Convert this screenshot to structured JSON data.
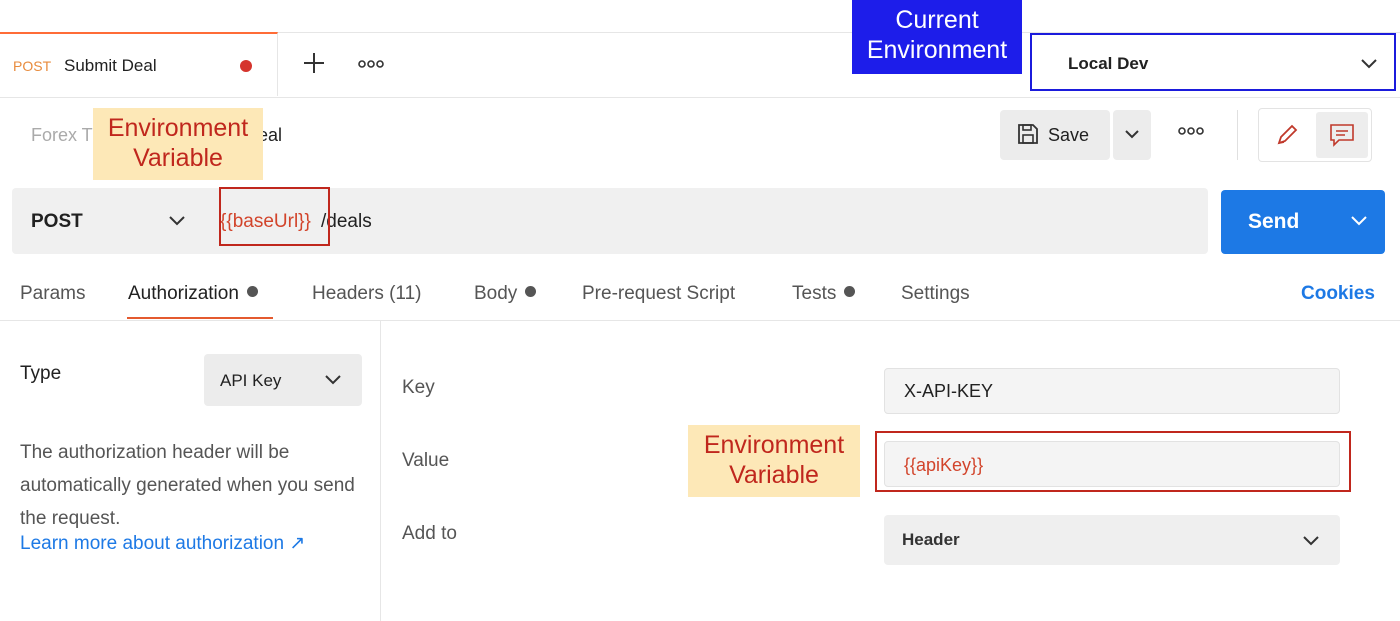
{
  "request_tab": {
    "method": "POST",
    "title": "Submit Deal"
  },
  "environment": {
    "selected": "Local Dev"
  },
  "annotations": {
    "current_environment": "Current Environment",
    "env_variable_1": "Environment Variable",
    "env_variable_2": "Environment Variable"
  },
  "breadcrumb": {
    "collection": "Forex T",
    "request": "eal"
  },
  "toolbar": {
    "save_label": "Save"
  },
  "url_bar": {
    "method": "POST",
    "url_variable": "{{baseUrl}}",
    "url_path": "/deals",
    "send_label": "Send"
  },
  "request_tabs": [
    {
      "label": "Params"
    },
    {
      "label": "Authorization"
    },
    {
      "label": "Headers (11)"
    },
    {
      "label": "Body"
    },
    {
      "label": "Pre-request Script"
    },
    {
      "label": "Tests"
    },
    {
      "label": "Settings"
    }
  ],
  "cookies_label": "Cookies",
  "auth": {
    "type_label": "Type",
    "type_value": "API Key",
    "description": "The authorization header will be automatically generated when you send the request.",
    "learn_more": "Learn more about authorization ↗",
    "key_label": "Key",
    "key_value": "X-API-KEY",
    "value_label": "Value",
    "value_value": "{{apiKey}}",
    "add_to_label": "Add to",
    "add_to_value": "Header"
  },
  "colors": {
    "accent": "#1d79e5",
    "variable": "#d2442b",
    "annotation_border": "#c0271d",
    "annotation_blue": "#1d1dea"
  }
}
